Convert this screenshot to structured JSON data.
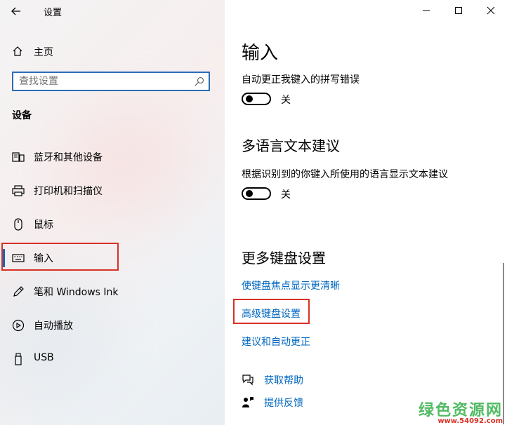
{
  "window": {
    "title": "设置"
  },
  "sidebar": {
    "home_label": "主页",
    "search_placeholder": "查找设置",
    "section_title": "设备",
    "items": [
      {
        "label": "蓝牙和其他设备",
        "icon": "bluetooth-devices-icon"
      },
      {
        "label": "打印机和扫描仪",
        "icon": "printer-icon"
      },
      {
        "label": "鼠标",
        "icon": "mouse-icon"
      },
      {
        "label": "输入",
        "icon": "keyboard-icon",
        "active": true
      },
      {
        "label": "笔和 Windows Ink",
        "icon": "pen-icon"
      },
      {
        "label": "自动播放",
        "icon": "autoplay-icon"
      },
      {
        "label": "USB",
        "icon": "usb-icon"
      }
    ]
  },
  "main": {
    "page_title": "输入",
    "autocorrect": {
      "label": "自动更正我键入的拼写错误",
      "state": "关"
    },
    "suggestions": {
      "title": "多语言文本建议",
      "label": "根据识别到的你键入所使用的语言显示文本建议",
      "state": "关"
    },
    "more_keyboard": {
      "title": "更多键盘设置",
      "links": [
        "使键盘焦点显示更清晰",
        "高级键盘设置",
        "建议和自动更正"
      ]
    },
    "help": {
      "get_help": "获取帮助",
      "feedback": "提供反馈"
    }
  },
  "watermark": {
    "main": "绿色资源网",
    "sub": "www.54092.com"
  },
  "colors": {
    "accent": "#0067c0",
    "highlight": "#d93025"
  }
}
